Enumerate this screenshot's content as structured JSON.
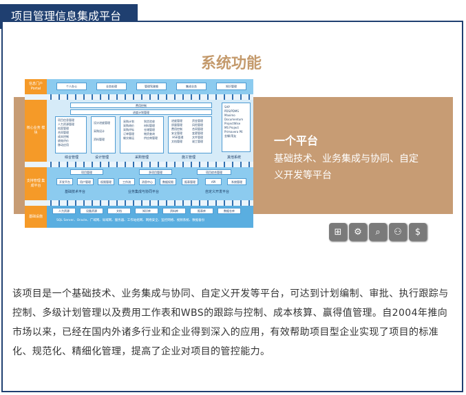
{
  "header": {
    "tab_title": "项目管理信息集成平台"
  },
  "diagram": {
    "title": "系统功能",
    "rows": [
      {
        "label": "信息门户 Portal",
        "items": [
          "个人办公",
          "业务处理",
          "管理驾驶舱",
          "集成业务",
          "知识管理"
        ]
      },
      {
        "label": "核心业务 模块",
        "top_bars": [
          "费用控制",
          "进度计划管理"
        ],
        "blocks": [
          {
            "name": "综合管理",
            "lines": [
              "项目信息管理\n人力资源管理\n档案管理\n合同管理\n成本控制\n绩效评价\n移动应用"
            ]
          },
          {
            "name": "设计管理",
            "lines": [
              "设计进度管理\n\n采购设计\n\n资料管理"
            ]
          },
          {
            "name": "采购管理",
            "lines": [
              "采购计划\n采购询价\n采购评标\n订单管理\n催交催运",
              "到货验收\n材料管理\n仓储管理\n物资查询\n供应商管理"
            ]
          },
          {
            "name": "施工管理",
            "lines": [
              "进度管理\n质量管理\n费用控制\n安全管理\n HSE管理\n文档管理",
              "资金管理\n风险管理\n合同管理\n变更管理\n文件管理\n竣工管理"
            ]
          }
        ],
        "right_block": {
          "name": "其他系统",
          "lines": [
            "SAP\nPDS/PDMS\nMaximo\nDocumentum\nProjectWise\nMS Project\nPrimavera P6\n金蝶/用友"
          ]
        }
      },
      {
        "label": "支持管理 集成平台",
        "groups": [
          "项目管理",
          "多项目管理",
          "项目综合管理"
        ],
        "items": [
          "开发平台",
          "用户管理",
          "权限管理",
          "工作流",
          "消息中心",
          "数据权限",
          "报表管理",
          "API",
          "系统管理"
        ],
        "flows": [
          "基础技术平台",
          "业务集成与协同平台",
          "自定义开发平台"
        ]
      },
      {
        "label": "基础设施",
        "items": [
          "人力资源",
          "设备资源",
          "文档",
          "知识库",
          "资料库",
          "报表库",
          "数据仓库"
        ],
        "tech": "SQL Server、Oracle、广域网、局域网、服务器、工作站组网、网络安全、监控网络、视频系统、数据备份"
      }
    ]
  },
  "banner": {
    "title": "一个平台",
    "subtitle": "基础技术、业务集成与协同、自定义开发等平台"
  },
  "toolbar_icons": [
    "abacus-icon",
    "gear-icon",
    "magnifier-icon",
    "hierarchy-icon",
    "money-bag-icon"
  ],
  "toolbar_glyphs": [
    "⊞",
    "⚙",
    "⌕",
    "⚇",
    "$"
  ],
  "description": "该项目是一个基础技术、业务集成与协同、自定义开发等平台，可达到计划编制、审批、执行跟踪与控制、多级计划管理以及费用工作表和WBS的跟踪与控制、成本核算、赢得值管理。自2004年推向市场以来，已经在国内外诸多行业和企业得到深入的应用，有效帮助项目型企业实现了项目的标准化、规范化、精细化管理，提高了企业对项目的管控能力。"
}
